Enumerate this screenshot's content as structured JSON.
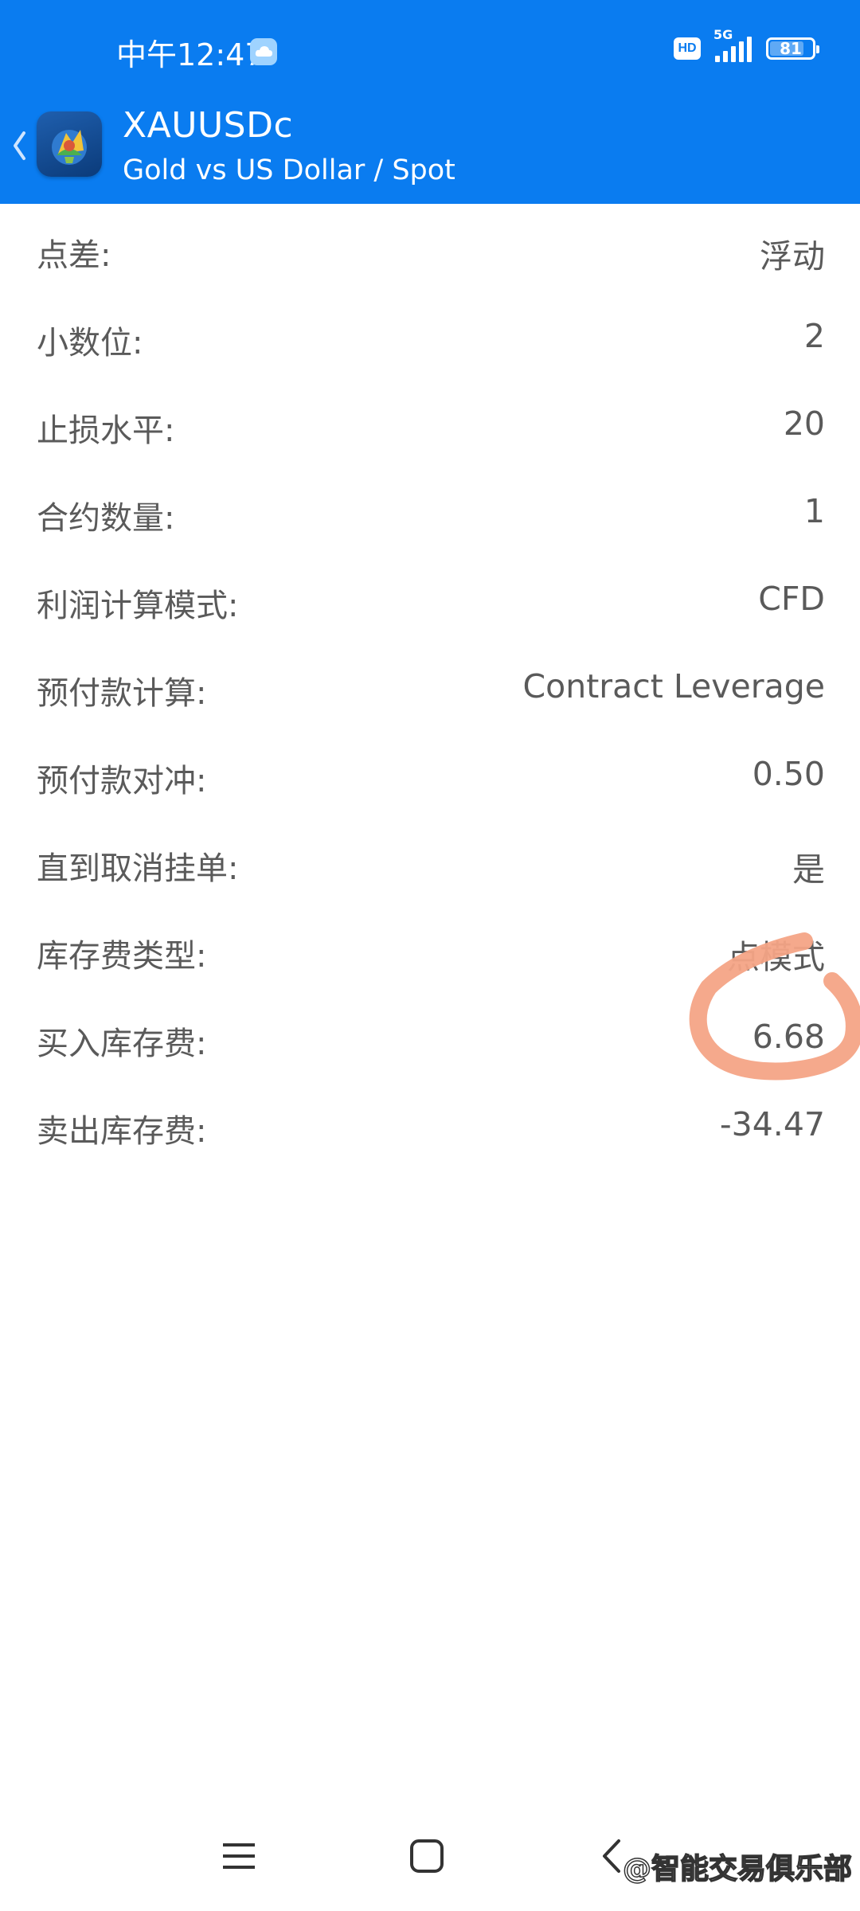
{
  "status_bar": {
    "time": "中午12:47",
    "hd": "HD",
    "network": "5G",
    "battery": "81",
    "battery_level": 0.81
  },
  "header": {
    "symbol": "XAUUSDc",
    "description": "Gold vs US Dollar / Spot"
  },
  "properties": [
    {
      "label": "点差:",
      "value": "浮动"
    },
    {
      "label": "小数位:",
      "value": "2"
    },
    {
      "label": "止损水平:",
      "value": "20"
    },
    {
      "label": "合约数量:",
      "value": "1"
    },
    {
      "label": "利润计算模式:",
      "value": "CFD"
    },
    {
      "label": "预付款计算:",
      "value": "Contract Leverage"
    },
    {
      "label": "预付款对冲:",
      "value": "0.50"
    },
    {
      "label": "直到取消挂单:",
      "value": "是"
    },
    {
      "label": "库存费类型:",
      "value": "点模式"
    },
    {
      "label": "买入库存费:",
      "value": "6.68"
    },
    {
      "label": "卖出库存费:",
      "value": "-34.47"
    }
  ],
  "colors": {
    "accent": "#0a7cf0",
    "annotation": "#f4a486",
    "text": "#5a5a5a"
  },
  "watermark": "@智能交易俱乐部",
  "icons": {
    "back": "chevron-left-icon",
    "app": "metatrader-logo-icon",
    "cloud": "cloud-icon",
    "menu": "menu-icon",
    "home": "home-icon",
    "nav_back": "back-icon"
  }
}
